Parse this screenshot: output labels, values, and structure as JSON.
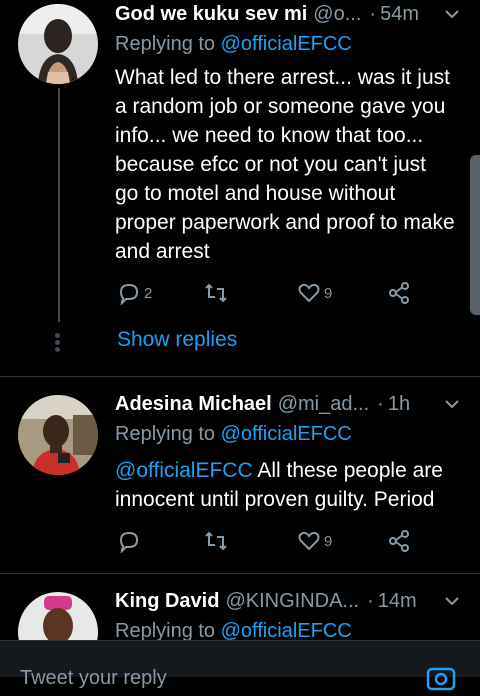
{
  "tweets": [
    {
      "name": "God we kuku sev mi",
      "handle": "@o...",
      "time": "54m",
      "replying_prefix": "Replying to",
      "replying_to": "@officialEFCC",
      "mention": "",
      "text": "What led to there arrest... was it just a random job or someone gave you info... we need to know that too... because efcc or not you can't just go to motel and house without proper paperwork and proof to make and arrest",
      "replies": "2",
      "retweets": "",
      "likes": "9"
    },
    {
      "name": "Adesina Michael",
      "handle": "@mi_ad...",
      "time": "1h",
      "replying_prefix": "Replying to",
      "replying_to": "@officialEFCC",
      "mention": "@officialEFCC",
      "text": " All these people are innocent until proven guilty. Period",
      "replies": "",
      "retweets": "",
      "likes": "9"
    },
    {
      "name": "King David",
      "handle": "@KINGINDA...",
      "time": "14m",
      "replying_prefix": "Replying to",
      "replying_to": "@officialEFCC"
    }
  ],
  "show_replies": "Show replies",
  "compose": {
    "placeholder": "Tweet your reply"
  },
  "colors": {
    "accent": "#1da1f2",
    "muted": "#8899a6",
    "background": "#000000"
  },
  "icons": [
    "reply-icon",
    "retweet-icon",
    "like-icon",
    "share-icon",
    "chevron-down-icon",
    "camera-icon"
  ]
}
